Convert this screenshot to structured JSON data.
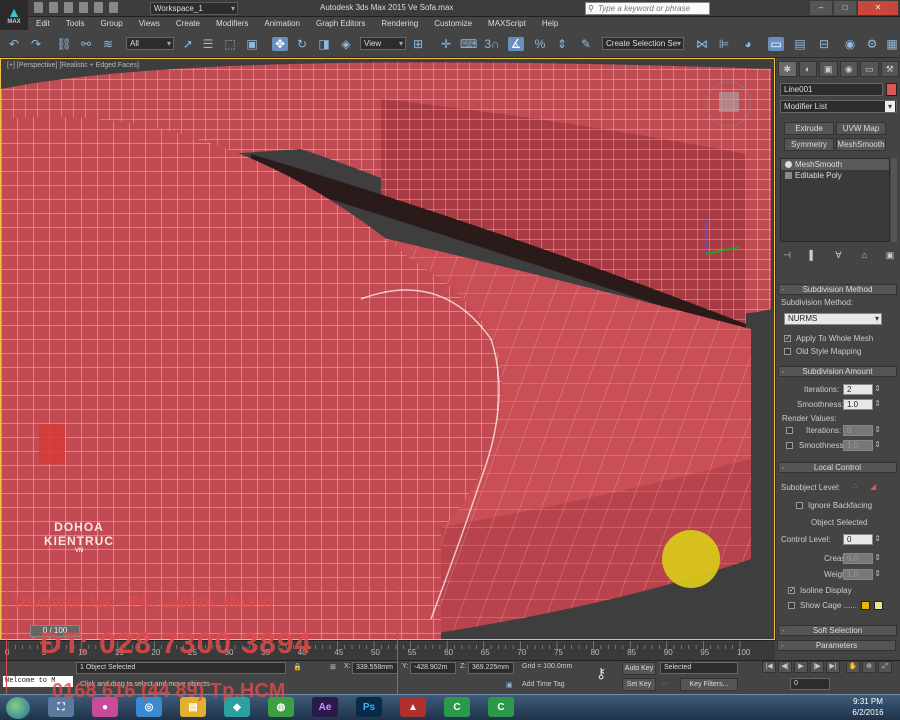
{
  "app": {
    "logo_label": "MAX",
    "title": "Autodesk 3ds Max  2015    Ve Sofa.max",
    "workspace": "Workspace_1",
    "search_placeholder": "Type a keyword or phrase"
  },
  "menu": [
    "Edit",
    "Tools",
    "Group",
    "Views",
    "Create",
    "Modifiers",
    "Animation",
    "Graph Editors",
    "Rendering",
    "Customize",
    "MAXScript",
    "Help"
  ],
  "toolbar": {
    "selection_filter": "All",
    "reference_coord": "View",
    "named_selection": "Create Selection Se",
    "snap_count": "3"
  },
  "viewport": {
    "label": "[+] [Perspective] [Realistic + Edged Faces]",
    "mesh_color": "#c04a52",
    "wire_color": "#f4f4f4"
  },
  "watermark": {
    "line1": "DOHOA",
    "line2": "KIENTRUC",
    "line3": "VN",
    "overlay1": "Truongtin.top - PC, Laptop, Mua in",
    "overlay2": "ĐT: 028 7300 3894",
    "overlay3": "0168 616 (44 89) Tp.HCM"
  },
  "command_panel": {
    "tabs": [
      "✱",
      "◐",
      "▣",
      "◉",
      "▭",
      "⚒"
    ],
    "object_name": "Line001",
    "object_color": "#e05555",
    "modifier_list": "Modifier List",
    "buttons": [
      "Extrude",
      "UVW Map",
      "Symmetry",
      "MeshSmooth"
    ],
    "stack": [
      "MeshSmooth",
      "Editable Poly"
    ],
    "stack_tools": [
      "⊣",
      "▌",
      "∀",
      "⌂",
      "▣"
    ],
    "subdivision_method": {
      "title": "Subdivision Method",
      "label": "Subdivision Method:",
      "value": "NURMS",
      "apply_whole_mesh": "Apply To Whole Mesh",
      "old_style": "Old Style Mapping"
    },
    "subdivision_amount": {
      "title": "Subdivision Amount",
      "iterations_label": "Iterations:",
      "iterations": "2",
      "smoothness_label": "Smoothness:",
      "smoothness": "1.0",
      "render_values": "Render Values:",
      "r_iterations_label": "Iterations:",
      "r_iterations": "0",
      "r_smoothness_label": "Smoothness:",
      "r_smoothness": "1.0"
    },
    "local_control": {
      "title": "Local Control",
      "subobject_level": "Subobject Level:",
      "ignore_backfacing": "Ignore Backfacing",
      "object_selected": "Object Selected",
      "control_level_label": "Control Level:",
      "control_level": "0",
      "crease_label": "Crease:",
      "crease": "0.0",
      "weight_label": "Weight:",
      "weight": "1.0",
      "isoline_display": "Isoline Display",
      "show_cage": "Show Cage ......",
      "cage_color1": "#e8b800",
      "cage_color2": "#f0e090"
    },
    "soft_selection": "Soft Selection",
    "parameters": "Parameters"
  },
  "timeline": {
    "slider": "0 / 100",
    "ticks": [
      "0",
      "5",
      "10",
      "15",
      "20",
      "25",
      "30",
      "35",
      "40",
      "45",
      "50",
      "55",
      "60",
      "65",
      "70",
      "75",
      "80",
      "85",
      "90",
      "95",
      "100"
    ]
  },
  "status": {
    "selection_count": "1 Object Selected",
    "prompt": "Click and drag to select and move objects",
    "maxscript": "Welcome to M",
    "x_label": "X:",
    "x": "339.558mm",
    "y_label": "Y:",
    "y": "-428.902m",
    "z_label": "Z:",
    "z": "369.225mm",
    "grid": "Grid = 100.0mm",
    "add_time_tag": "Add Time Tag",
    "auto_key": "Auto Key",
    "key_mode": "Selected",
    "set_key": "Set Key",
    "key_filters": "Key Filters...",
    "frame": "0"
  },
  "taskbar": {
    "time": "9:31 PM",
    "date": "6/2/2016",
    "apps": [
      "⛶",
      "●",
      "◎",
      "▤",
      "◆",
      "◍",
      "Ae",
      "Ps",
      "▲",
      "C",
      "C"
    ]
  }
}
